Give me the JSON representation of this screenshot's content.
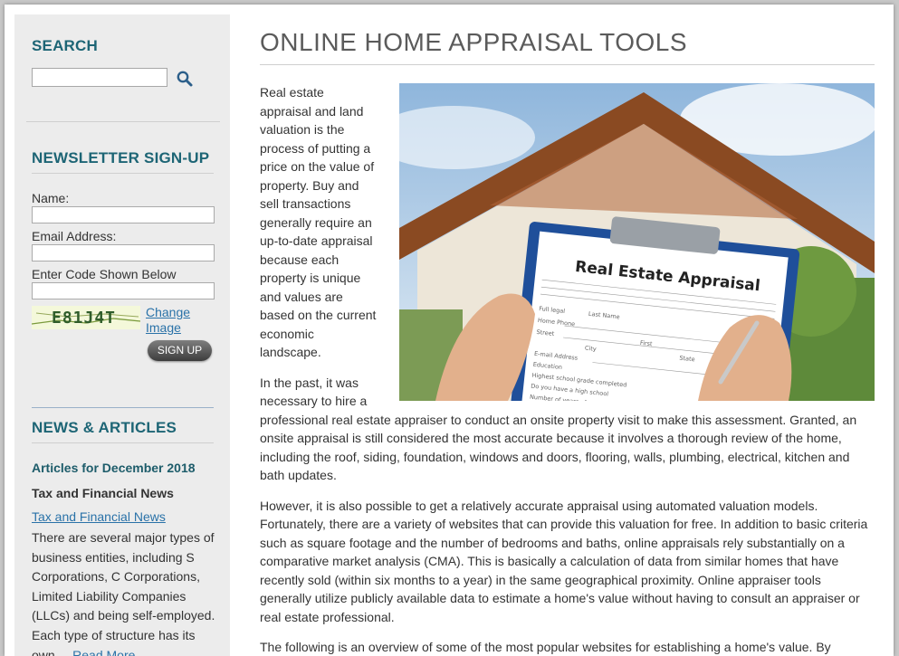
{
  "sidebar": {
    "search": {
      "heading": "SEARCH",
      "value": "",
      "placeholder": ""
    },
    "newsletter": {
      "heading": "NEWSLETTER SIGN-UP",
      "name_label": "Name:",
      "email_label": "Email Address:",
      "code_label": "Enter Code Shown Below",
      "captcha_text": "E81J4T",
      "change_link": "Change Image",
      "signup_label": "SIGN UP"
    },
    "news": {
      "heading": "NEWS & ARTICLES",
      "month": "Articles for December 2018",
      "category": "Tax and Financial News",
      "article_link": "Tax and Financial News",
      "article_text": "There are several major types of business entities, including S Corporations, C Corporations, Limited Liability Companies (LLCs) and being self-employed. Each type of structure has its own...",
      "read_more": "Read More"
    }
  },
  "main": {
    "title": "ONLINE HOME APPRAISAL TOOLS",
    "image": {
      "clipboard_heading": "Real Estate Appraisal",
      "form_labels": [
        "Full legal",
        "Last Name",
        "Home Phone",
        "Street",
        "First",
        "City",
        "State",
        "E-mail Address",
        "Education",
        "Highest school grade completed",
        "Do you have a high school",
        "Number of years of"
      ]
    },
    "paragraphs": [
      "Real estate appraisal and land valuation is the process of putting a price on the value of property. Buy and sell transactions generally require an up-to-date appraisal because each property is unique and values are based on the current economic landscape.",
      "In the past, it was necessary to hire a professional real estate appraiser to conduct an onsite property visit to make this assessment. Granted, an onsite appraisal is still considered the most accurate because it involves a thorough review of the home, including the roof, siding, foundation, windows and doors, flooring, walls, plumbing, electrical, kitchen and bath updates.",
      "However, it is also possible to get a relatively accurate appraisal using automated valuation models. Fortunately, there are a variety of websites that can provide this valuation for free. In addition to basic criteria such as square footage and the number of bedrooms and baths, online appraisals rely substantially on a comparative market analysis (CMA). This is basically a calculation of data from similar homes that have recently sold (within six months to a year) in the same geographical proximity. Online appraiser tools generally utilize publicly available data to estimate a home's value without having to consult an appraiser or real estate professional.",
      "The following is an overview of some of the most popular websites for establishing a home's value. By comparing the estimates of several sites, you might be able to establish a reliable value or value range."
    ]
  },
  "colors": {
    "heading": "#1d6575",
    "link": "#2a72a8",
    "sidebar_bg": "#ececec"
  }
}
